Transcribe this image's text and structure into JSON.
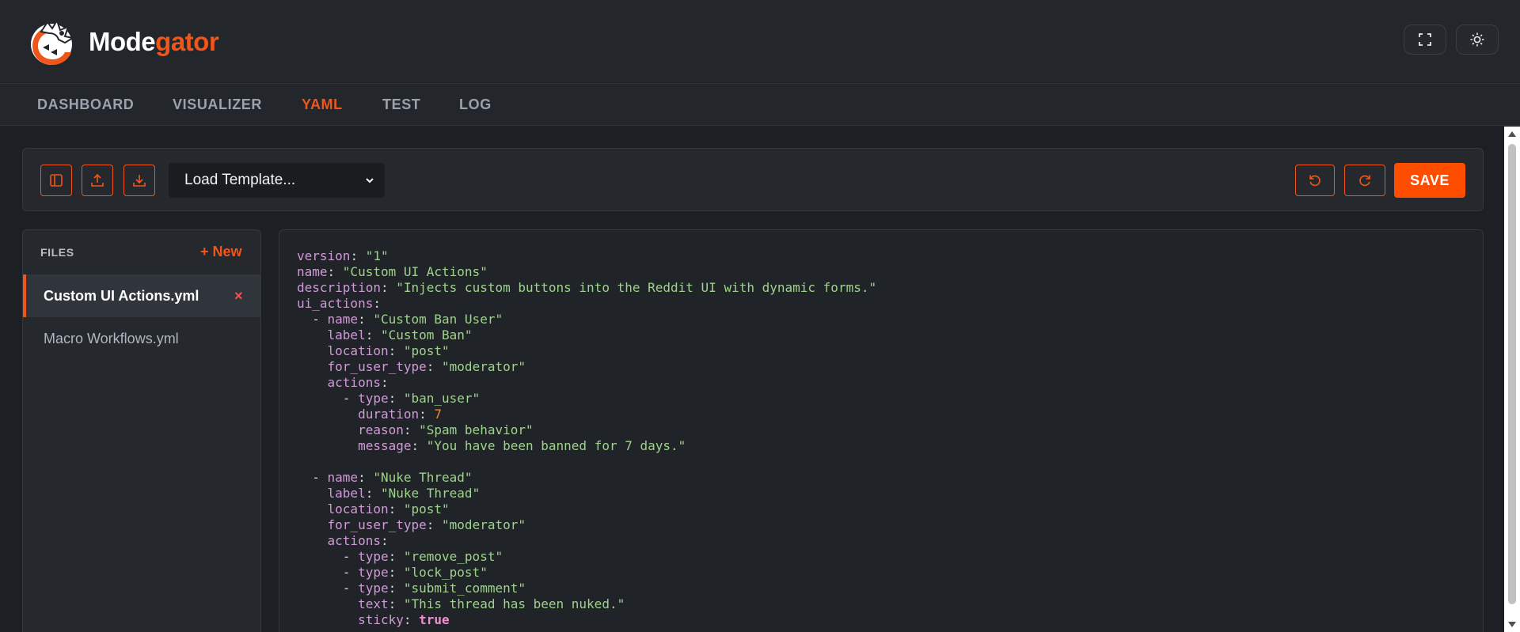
{
  "app": {
    "brand_part1": "Mode",
    "brand_part2": "gator",
    "accent_color": "#f0561a"
  },
  "header": {
    "fullscreen_icon": "fullscreen-icon",
    "theme_icon": "sun-icon"
  },
  "nav": {
    "tabs": [
      {
        "label": "DASHBOARD",
        "active": false
      },
      {
        "label": "VISUALIZER",
        "active": false
      },
      {
        "label": "YAML",
        "active": true
      },
      {
        "label": "TEST",
        "active": false
      },
      {
        "label": "LOG",
        "active": false
      }
    ]
  },
  "toolbar": {
    "template_select_value": "Load Template...",
    "save_label": "SAVE"
  },
  "files": {
    "title": "FILES",
    "new_label": "+ New",
    "close_glyph": "×",
    "items": [
      {
        "name": "Custom UI Actions.yml",
        "active": true
      },
      {
        "name": "Macro Workflows.yml",
        "active": false
      }
    ]
  },
  "editor": {
    "lines": [
      [
        {
          "t": "k",
          "v": "version"
        },
        {
          "t": "p",
          "v": ": "
        },
        {
          "t": "s",
          "v": "\"1\""
        }
      ],
      [
        {
          "t": "k",
          "v": "name"
        },
        {
          "t": "p",
          "v": ": "
        },
        {
          "t": "s",
          "v": "\"Custom UI Actions\""
        }
      ],
      [
        {
          "t": "k",
          "v": "description"
        },
        {
          "t": "p",
          "v": ": "
        },
        {
          "t": "s",
          "v": "\"Injects custom buttons into the Reddit UI with dynamic forms.\""
        }
      ],
      [
        {
          "t": "k",
          "v": "ui_actions"
        },
        {
          "t": "p",
          "v": ":"
        }
      ],
      [
        {
          "t": "p",
          "v": "  - "
        },
        {
          "t": "k",
          "v": "name"
        },
        {
          "t": "p",
          "v": ": "
        },
        {
          "t": "s",
          "v": "\"Custom Ban User\""
        }
      ],
      [
        {
          "t": "p",
          "v": "    "
        },
        {
          "t": "k",
          "v": "label"
        },
        {
          "t": "p",
          "v": ": "
        },
        {
          "t": "s",
          "v": "\"Custom Ban\""
        }
      ],
      [
        {
          "t": "p",
          "v": "    "
        },
        {
          "t": "k",
          "v": "location"
        },
        {
          "t": "p",
          "v": ": "
        },
        {
          "t": "s",
          "v": "\"post\""
        }
      ],
      [
        {
          "t": "p",
          "v": "    "
        },
        {
          "t": "k",
          "v": "for_user_type"
        },
        {
          "t": "p",
          "v": ": "
        },
        {
          "t": "s",
          "v": "\"moderator\""
        }
      ],
      [
        {
          "t": "p",
          "v": "    "
        },
        {
          "t": "k",
          "v": "actions"
        },
        {
          "t": "p",
          "v": ":"
        }
      ],
      [
        {
          "t": "p",
          "v": "      - "
        },
        {
          "t": "k",
          "v": "type"
        },
        {
          "t": "p",
          "v": ": "
        },
        {
          "t": "s",
          "v": "\"ban_user\""
        }
      ],
      [
        {
          "t": "p",
          "v": "        "
        },
        {
          "t": "k",
          "v": "duration"
        },
        {
          "t": "p",
          "v": ": "
        },
        {
          "t": "n",
          "v": "7"
        }
      ],
      [
        {
          "t": "p",
          "v": "        "
        },
        {
          "t": "k",
          "v": "reason"
        },
        {
          "t": "p",
          "v": ": "
        },
        {
          "t": "s",
          "v": "\"Spam behavior\""
        }
      ],
      [
        {
          "t": "p",
          "v": "        "
        },
        {
          "t": "k",
          "v": "message"
        },
        {
          "t": "p",
          "v": ": "
        },
        {
          "t": "s",
          "v": "\"You have been banned for 7 days.\""
        }
      ],
      [],
      [
        {
          "t": "p",
          "v": "  - "
        },
        {
          "t": "k",
          "v": "name"
        },
        {
          "t": "p",
          "v": ": "
        },
        {
          "t": "s",
          "v": "\"Nuke Thread\""
        }
      ],
      [
        {
          "t": "p",
          "v": "    "
        },
        {
          "t": "k",
          "v": "label"
        },
        {
          "t": "p",
          "v": ": "
        },
        {
          "t": "s",
          "v": "\"Nuke Thread\""
        }
      ],
      [
        {
          "t": "p",
          "v": "    "
        },
        {
          "t": "k",
          "v": "location"
        },
        {
          "t": "p",
          "v": ": "
        },
        {
          "t": "s",
          "v": "\"post\""
        }
      ],
      [
        {
          "t": "p",
          "v": "    "
        },
        {
          "t": "k",
          "v": "for_user_type"
        },
        {
          "t": "p",
          "v": ": "
        },
        {
          "t": "s",
          "v": "\"moderator\""
        }
      ],
      [
        {
          "t": "p",
          "v": "    "
        },
        {
          "t": "k",
          "v": "actions"
        },
        {
          "t": "p",
          "v": ":"
        }
      ],
      [
        {
          "t": "p",
          "v": "      - "
        },
        {
          "t": "k",
          "v": "type"
        },
        {
          "t": "p",
          "v": ": "
        },
        {
          "t": "s",
          "v": "\"remove_post\""
        }
      ],
      [
        {
          "t": "p",
          "v": "      - "
        },
        {
          "t": "k",
          "v": "type"
        },
        {
          "t": "p",
          "v": ": "
        },
        {
          "t": "s",
          "v": "\"lock_post\""
        }
      ],
      [
        {
          "t": "p",
          "v": "      - "
        },
        {
          "t": "k",
          "v": "type"
        },
        {
          "t": "p",
          "v": ": "
        },
        {
          "t": "s",
          "v": "\"submit_comment\""
        }
      ],
      [
        {
          "t": "p",
          "v": "        "
        },
        {
          "t": "k",
          "v": "text"
        },
        {
          "t": "p",
          "v": ": "
        },
        {
          "t": "s",
          "v": "\"This thread has been nuked.\""
        }
      ],
      [
        {
          "t": "p",
          "v": "        "
        },
        {
          "t": "k",
          "v": "sticky"
        },
        {
          "t": "p",
          "v": ": "
        },
        {
          "t": "b",
          "v": "true"
        }
      ]
    ]
  }
}
